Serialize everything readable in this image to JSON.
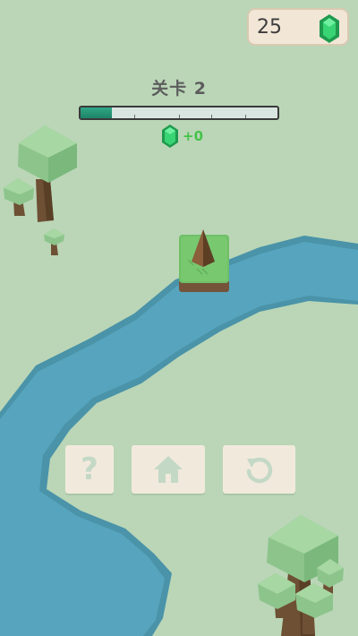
{
  "hud": {
    "gem_count": "25",
    "gem_icon": "emerald-gem-icon"
  },
  "level": {
    "label": "关卡 2",
    "progress": 0.16,
    "reward_text": "+0",
    "reward_icon": "emerald-gem-icon"
  },
  "controls": {
    "help": {
      "icon": "question-mark-icon",
      "glyph": "?"
    },
    "home": {
      "icon": "home-icon"
    },
    "restart": {
      "icon": "restart-icon"
    }
  },
  "colors": {
    "grass": "#bad6b7",
    "river": "#56a4bd",
    "river_bank": "#4a93a8",
    "gem": "#2fc46c",
    "progress": "#2fa685",
    "button": "#f1eadc",
    "button_icon": "#c4d8c6",
    "reward_text": "#45c24a"
  }
}
